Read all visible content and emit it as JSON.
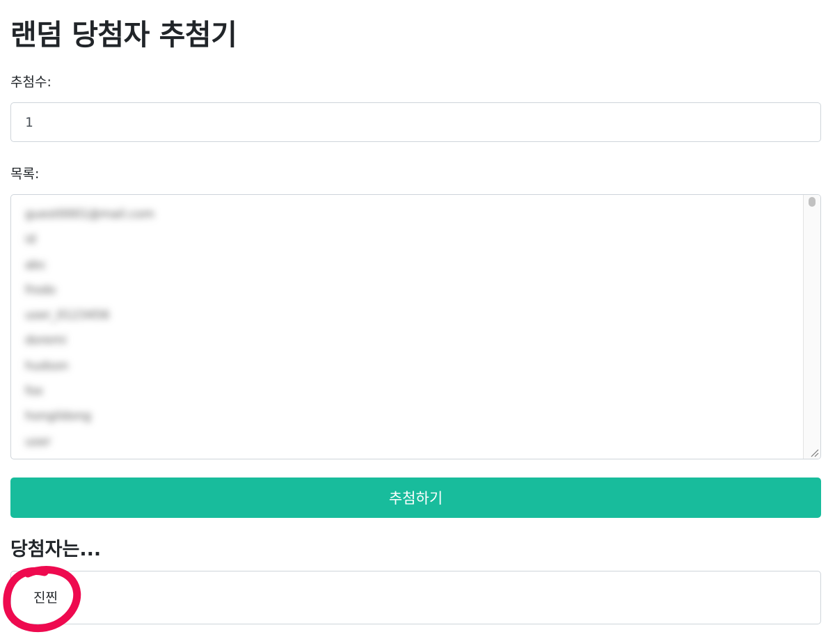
{
  "page": {
    "title": "랜덤 당첨자 추첨기"
  },
  "form": {
    "count_label": "추첨수:",
    "count_value": "1",
    "list_label": "목록:",
    "list_items": [
      "guest0001@mail.com",
      "id",
      "abc",
      "frodo",
      "user_0123456",
      "doremi",
      "hudson",
      "fox",
      "hongildong",
      "user"
    ],
    "submit_label": "추첨하기"
  },
  "result": {
    "heading": "당첨자는...",
    "winner": "진찐"
  },
  "colors": {
    "accent": "#18bc9c",
    "highlight_circle": "#ee0a4f",
    "border": "#ced4da"
  }
}
